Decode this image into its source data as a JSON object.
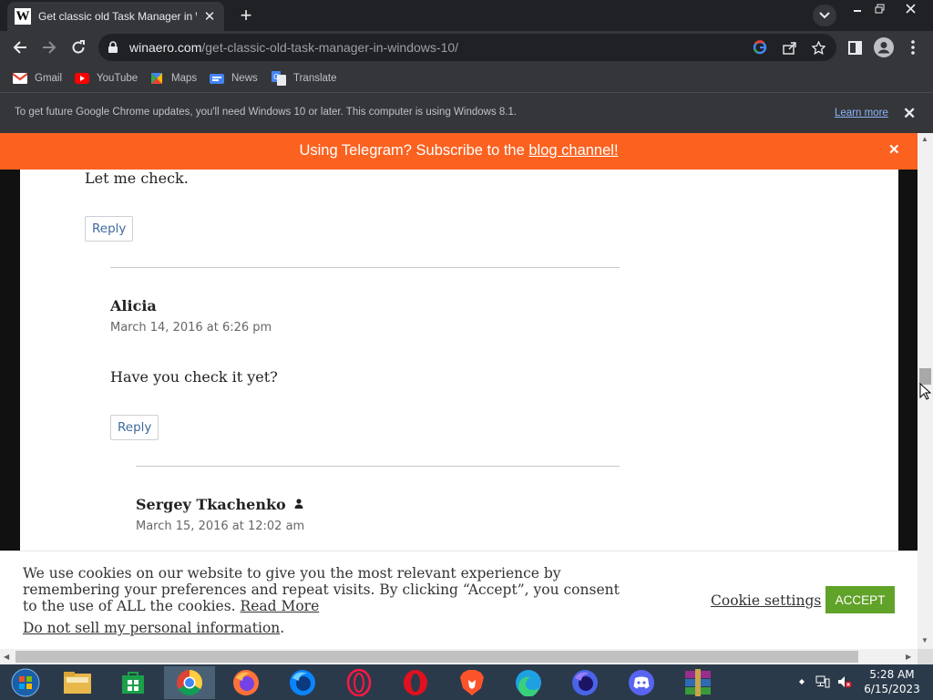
{
  "browser": {
    "tab_title": "Get classic old Task Manager in Windows 10",
    "tab_favicon": "W",
    "url_host": "winaero.com",
    "url_path": "/get-classic-old-task-manager-in-windows-10/",
    "bookmarks": [
      "Gmail",
      "YouTube",
      "Maps",
      "News",
      "Translate"
    ],
    "infobar_text": "To get future Google Chrome updates, you'll need Windows 10 or later. This computer is using Windows 8.1.",
    "infobar_link": "Learn more"
  },
  "telegram_banner": {
    "text": "Using Telegram? Subscribe to the ",
    "link": "blog channel!",
    "background": "#fb6220"
  },
  "comments": [
    {
      "text": "Let me check.",
      "reply_label": "Reply"
    },
    {
      "author": "Alicia",
      "date": "March 14, 2016 at 6:26 pm",
      "text": "Have you check it yet?",
      "reply_label": "Reply"
    },
    {
      "author": "Sergey Tkachenko",
      "date": "March 15, 2016 at 12:02 am"
    }
  ],
  "cookie_banner": {
    "text": "We use cookies on our website to give you the most relevant experience by remembering your preferences and repeat visits. By clicking “Accept”, you consent to the use of ALL the cookies. ",
    "read_more": "Read More",
    "do_not_sell": "Do not sell my personal information",
    "do_not_sell_suffix": ".",
    "settings_label": "Cookie settings",
    "accept_label": "ACCEPT",
    "accept_color": "#61a229"
  },
  "taskbar": {
    "time": "5:28 AM",
    "date": "6/15/2023"
  }
}
